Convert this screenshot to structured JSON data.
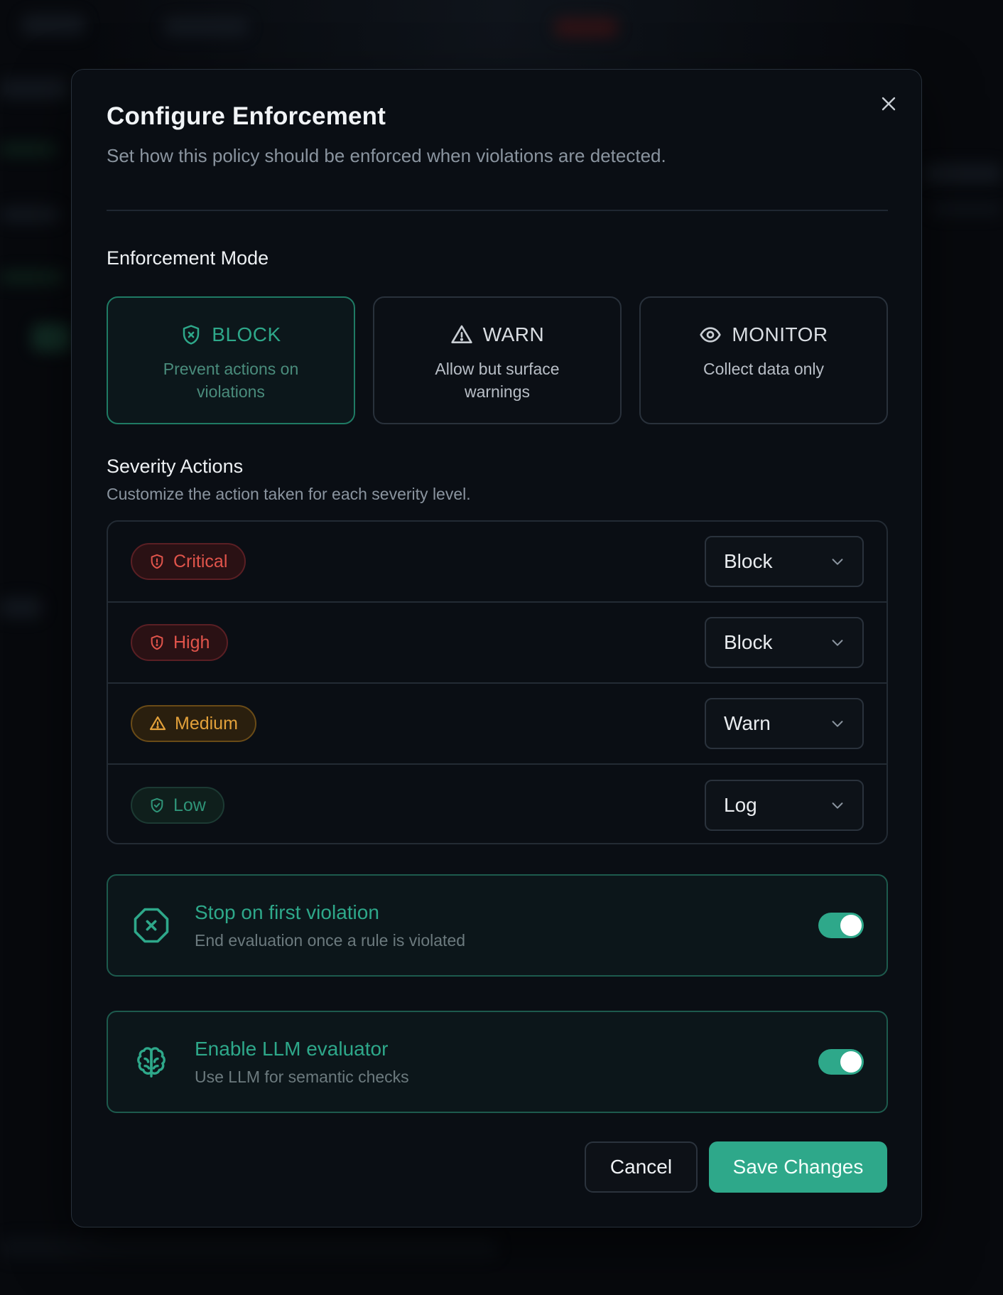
{
  "modal": {
    "title": "Configure Enforcement",
    "subtitle": "Set how this policy should be enforced when violations are detected."
  },
  "enforcement_mode": {
    "label": "Enforcement Mode",
    "selected": "BLOCK",
    "options": [
      {
        "name": "BLOCK",
        "description": "Prevent actions on violations",
        "icon": "shield-x-icon"
      },
      {
        "name": "WARN",
        "description": "Allow but surface warnings",
        "icon": "warning-triangle-icon"
      },
      {
        "name": "MONITOR",
        "description": "Collect data only",
        "icon": "eye-icon"
      }
    ]
  },
  "severity": {
    "label": "Severity Actions",
    "help": "Customize the action taken for each severity level.",
    "rows": [
      {
        "level": "Critical",
        "action": "Block",
        "icon": "shield-alert-icon"
      },
      {
        "level": "High",
        "action": "Block",
        "icon": "shield-alert-icon"
      },
      {
        "level": "Medium",
        "action": "Warn",
        "icon": "warning-triangle-icon"
      },
      {
        "level": "Low",
        "action": "Log",
        "icon": "shield-check-icon"
      }
    ]
  },
  "toggles": {
    "stop_first": {
      "title": "Stop on first violation",
      "description": "End evaluation once a rule is violated",
      "enabled": true,
      "icon": "octagon-x-icon"
    },
    "llm": {
      "title": "Enable LLM evaluator",
      "description": "Use LLM for semantic checks",
      "enabled": true,
      "icon": "brain-icon"
    }
  },
  "footer": {
    "cancel_label": "Cancel",
    "save_label": "Save Changes"
  },
  "colors": {
    "accent": "#2ea88a",
    "critical": "#e0544b",
    "medium": "#e3a13a",
    "low": "#2f9478"
  }
}
